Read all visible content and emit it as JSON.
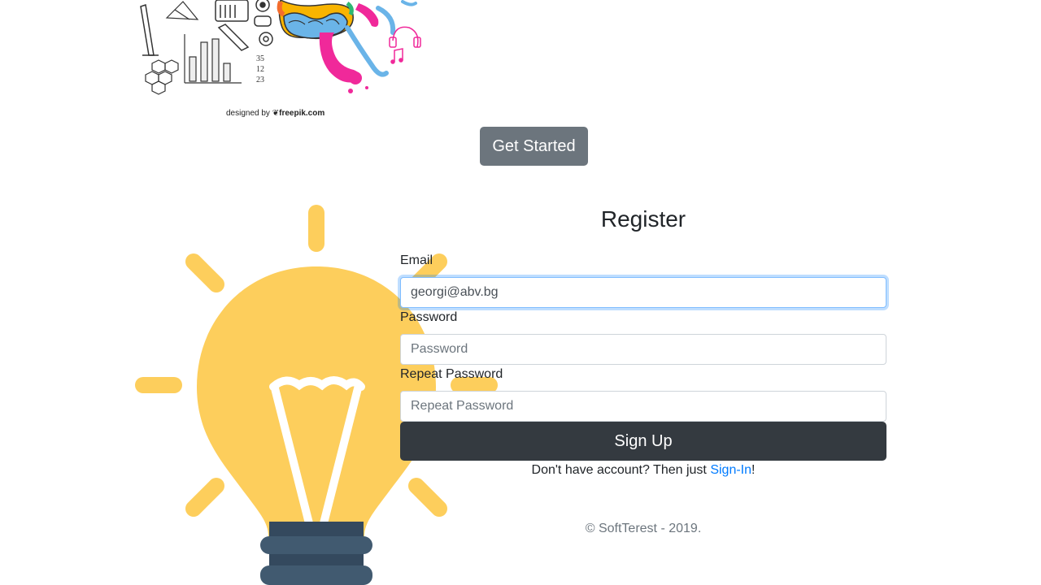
{
  "hero": {
    "credit_prefix": "designed by",
    "credit_brand": "freepik.com",
    "doodle_numbers": [
      "35",
      "12",
      "23"
    ]
  },
  "get_started_label": "Get Started",
  "register": {
    "title": "Register",
    "email_label": "Email",
    "email_value": "georgi@abv.bg",
    "password_label": "Password",
    "password_placeholder": "Password",
    "repeat_label": "Repeat Password",
    "repeat_placeholder": "Repeat Password",
    "signup_label": "Sign Up",
    "signin_prefix": "Don't have account? Then just ",
    "signin_link": "Sign-In",
    "signin_suffix": "!"
  },
  "footer": {
    "text": "© SoftTerest - 2019."
  },
  "colors": {
    "bulb_yellow": "#fdce5c",
    "bulb_base": "#415a70",
    "button_dark": "#343a40",
    "button_gray": "#6c757d",
    "link_blue": "#007bff",
    "focus_border": "#80bdff"
  },
  "icons": [
    "lightbulb-illustration",
    "freepik-logo-icon"
  ]
}
